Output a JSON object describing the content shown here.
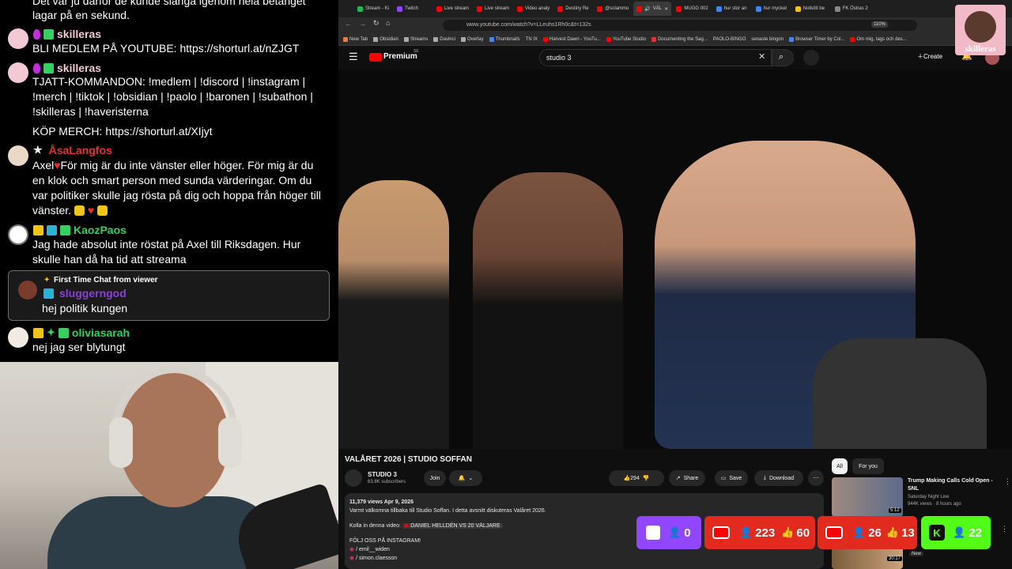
{
  "chat": {
    "top_line1": "Det var ju därför de kunde slänga igenom hela betänget",
    "top_line2": "lagar på en sekund.",
    "messages": [
      {
        "user": "skilleras",
        "color": "#f4c9d6",
        "lines": [
          "BLI MEDLEM PÅ YOUTUBE: https://shorturl.at/nZJGT"
        ]
      },
      {
        "user": "skilleras",
        "color": "#f4c9d6",
        "lines": [
          "TJATT-KOMMANDON: !medlem | !discord | !instagram |",
          "!merch | !tiktok | !obsidian | !paolo | !baronen | !subathon |",
          "!skilleras | !haveristerna"
        ],
        "extra": "KÖP MERCH: https://shorturl.at/XIjyt"
      },
      {
        "user": "ÅsaLangfos",
        "color": "#e8312e",
        "lines": [
          "Axel",
          "För mig är du inte vänster eller höger. För mig är du",
          "en klok och smart person med sunda värderingar. Om du",
          "var politiker skulle jag rösta på dig och hoppa från höger till",
          "vänster."
        ]
      },
      {
        "user": "KaozPaos",
        "color": "#34d160",
        "lines": [
          "Jag hade absolut inte röstat på Axel till Riksdagen. Hur",
          "skulle han då ha tid att streama"
        ]
      },
      {
        "first_time_label": "First Time Chat from viewer",
        "user": "sluggerngod",
        "color": "#8b3fd9",
        "lines": [
          "hej politik kungen"
        ]
      },
      {
        "user": "oliviasarah",
        "color": "#34d160",
        "lines": [
          "nej jag ser blytungt"
        ]
      }
    ]
  },
  "browser": {
    "tabs": [
      {
        "label": "Stream - Ki",
        "color": "#1db954"
      },
      {
        "label": "Twitch",
        "color": "#9146ff"
      },
      {
        "label": "Live stream",
        "color": "#ff0000"
      },
      {
        "label": "Live stream",
        "color": "#ff0000"
      },
      {
        "label": "Video analy",
        "color": "#ff0000"
      },
      {
        "label": "Destiny Re",
        "color": "#ff0000"
      },
      {
        "label": "@sclammo",
        "color": "#ff0000"
      },
      {
        "label": "VÄL",
        "color": "#ff0000",
        "active": true
      },
      {
        "label": "MUGG 002",
        "color": "#ff0000"
      },
      {
        "label": "hur stor an",
        "color": "#4285f4"
      },
      {
        "label": "hur mycket",
        "color": "#4285f4"
      },
      {
        "label": "Notkött be",
        "color": "#f0c419"
      },
      {
        "label": "FK Östras 2",
        "color": "#888888"
      }
    ],
    "url": "www.youtube.com/watch?v=LLeuhs1Rh0c&t=132s",
    "zoom": "110%",
    "bookmarks": [
      "New Tab",
      "Obsidian",
      "Streams",
      "Davinci",
      "Overlay",
      "Thumbnails",
      "TN IX",
      "Harvest Dawn - YouTu...",
      "YouTube Studio",
      "Documenting the Sag...",
      "PAOLO-BINGO",
      "senaste bingon",
      "Browser Timer by Col...",
      "Om mig, tags och des..."
    ]
  },
  "youtube": {
    "brand": "Premium",
    "brand_sup": "SE",
    "search_value": "studio 3",
    "create_label": "Create",
    "video_title": "VALÅRET 2026 | STUDIO SOFFAN",
    "channel": "STUDIO 3",
    "subscribers": "63.8K subscribers",
    "join_label": "Join",
    "likes": "294",
    "share_label": "Share",
    "save_label": "Save",
    "download_label": "Download",
    "views_date": "11,379 views  Apr 9, 2026",
    "desc_line1": "Varmt välkomna tillbaka till Studio Soffan. I detta avsnitt diskuteras Valåret 2026.",
    "desc_line2": "Kolla in denna video:",
    "desc_link": "DANIEL HELLDÉN VS 20 VÄLJARE",
    "desc_line3": "FÖLJ OSS PÅ INSTAGRAM!",
    "desc_insta1": "/ emil__widen",
    "desc_insta2": "/ simon.claesson",
    "chips": [
      "All",
      "For you"
    ],
    "rec_title": "Trump Making Calls Cold Open - SNL",
    "rec_channel": "Saturday Night Live",
    "rec_meta": "944K views · 8 hours ago",
    "rec_duration": "5:12",
    "rec2_duration": "30:17",
    "rec2_badge": "New"
  },
  "overlays": {
    "twitch_viewers": "0",
    "yt1_viewers": "223",
    "yt1_likes": "60",
    "yt2_viewers": "26",
    "yt2_likes": "13",
    "kick_viewers": "22",
    "streamer_name": "skilleras"
  }
}
